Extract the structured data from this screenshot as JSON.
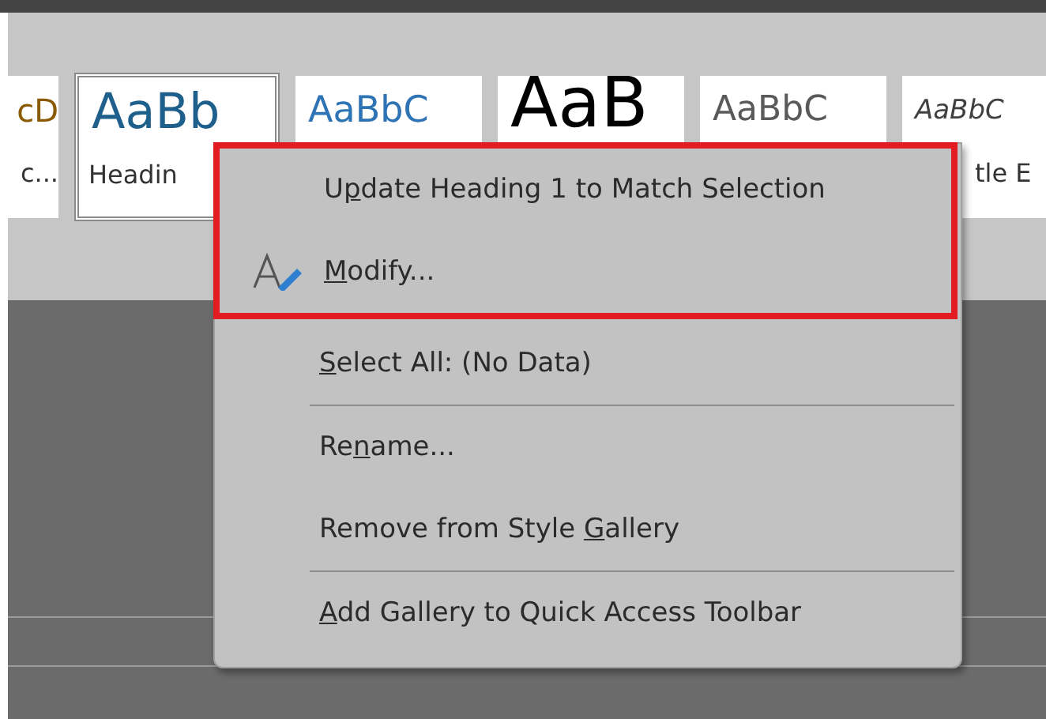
{
  "style_gallery": [
    {
      "preview": "cD",
      "label": "c...",
      "kind": "cut",
      "selected": false
    },
    {
      "preview": "AaBb",
      "label": "Headin",
      "kind": "heading1",
      "selected": true
    },
    {
      "preview": "AaBbC",
      "kind": "heading2",
      "selected": false
    },
    {
      "preview": "AaB",
      "kind": "title",
      "selected": false
    },
    {
      "preview": "AaBbC",
      "kind": "subtitle",
      "selected": false
    },
    {
      "preview": "AaBbC",
      "label": "tle E",
      "kind": "emphasis",
      "selected": false
    }
  ],
  "context_menu": {
    "items": [
      {
        "pre": "U",
        "key": "p",
        "post": "date Heading 1 to Match Selection",
        "kind": "plain",
        "highlighted": true,
        "separator_before": false
      },
      {
        "key": "M",
        "post": "odify...",
        "kind": "with-icon",
        "highlighted": true,
        "separator_before": false
      },
      {
        "key": "S",
        "post": "elect All: (No Data)",
        "kind": "plain",
        "highlighted": false,
        "separator_before": false
      },
      {
        "pre": "Re",
        "key": "n",
        "post": "ame...",
        "kind": "plain",
        "highlighted": false,
        "separator_before": true
      },
      {
        "pre": "Remove from Style ",
        "key": "G",
        "post": "allery",
        "kind": "plain",
        "highlighted": false,
        "separator_before": false
      },
      {
        "key": "A",
        "post": "dd Gallery to Quick Access Toolbar",
        "kind": "plain",
        "highlighted": false,
        "separator_before": true
      }
    ]
  }
}
